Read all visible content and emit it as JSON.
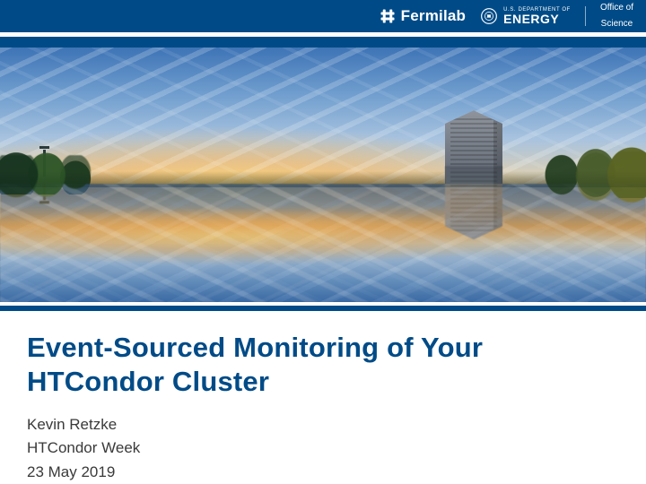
{
  "header": {
    "fermilab_label": "Fermilab",
    "doe_top": "U.S. DEPARTMENT OF",
    "doe_energy": "ENERGY",
    "office_top": "Office of",
    "office_bottom": "Science"
  },
  "title": {
    "line1": "Event-Sourced Monitoring of Your",
    "line2": "HTCondor Cluster"
  },
  "meta": {
    "author": "Kevin Retzke",
    "event": "HTCondor Week",
    "date": "23 May 2019"
  },
  "colors": {
    "brand_blue": "#004b87"
  }
}
